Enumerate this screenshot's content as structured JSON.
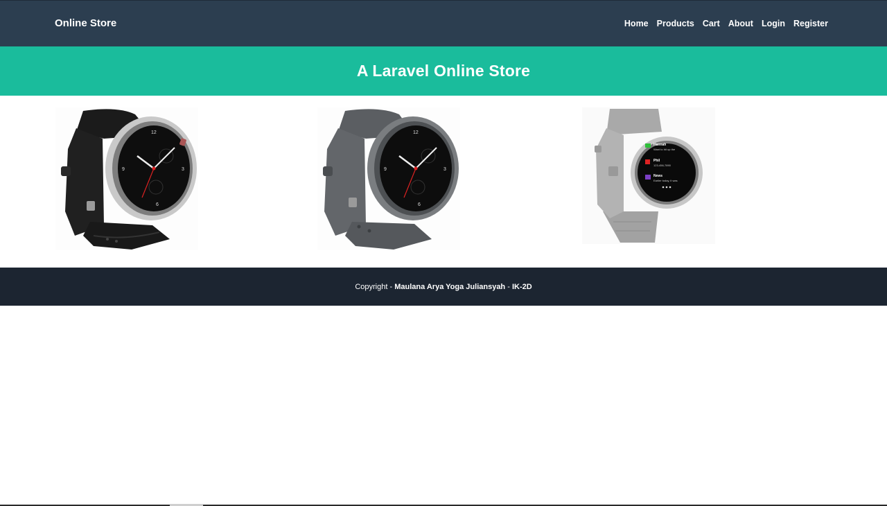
{
  "navbar": {
    "brand": "Online Store",
    "links": [
      "Home",
      "Products",
      "Cart",
      "About",
      "Login",
      "Register"
    ],
    "background": "#2c3e50"
  },
  "hero": {
    "title": "A Laravel Online Store",
    "background": "#1abc9c"
  },
  "products": [
    {
      "image": "black-smartwatch-image"
    },
    {
      "image": "grey-smartwatch-image"
    },
    {
      "image": "silver-smartwatch-image",
      "screen": {
        "items": [
          {
            "title": "Hannah",
            "subtitle": "Want to hit up the"
          },
          {
            "title": "Phil",
            "subtitle": "123-456-7890"
          },
          {
            "title": "News",
            "subtitle": "Earlier today, it was"
          }
        ]
      }
    }
  ],
  "footer": {
    "prefix": "Copyright - ",
    "author": "Maulana Arya Yoga Juliansyah",
    "separator": " - ",
    "class": "IK-2D",
    "background": "#1c2531"
  }
}
